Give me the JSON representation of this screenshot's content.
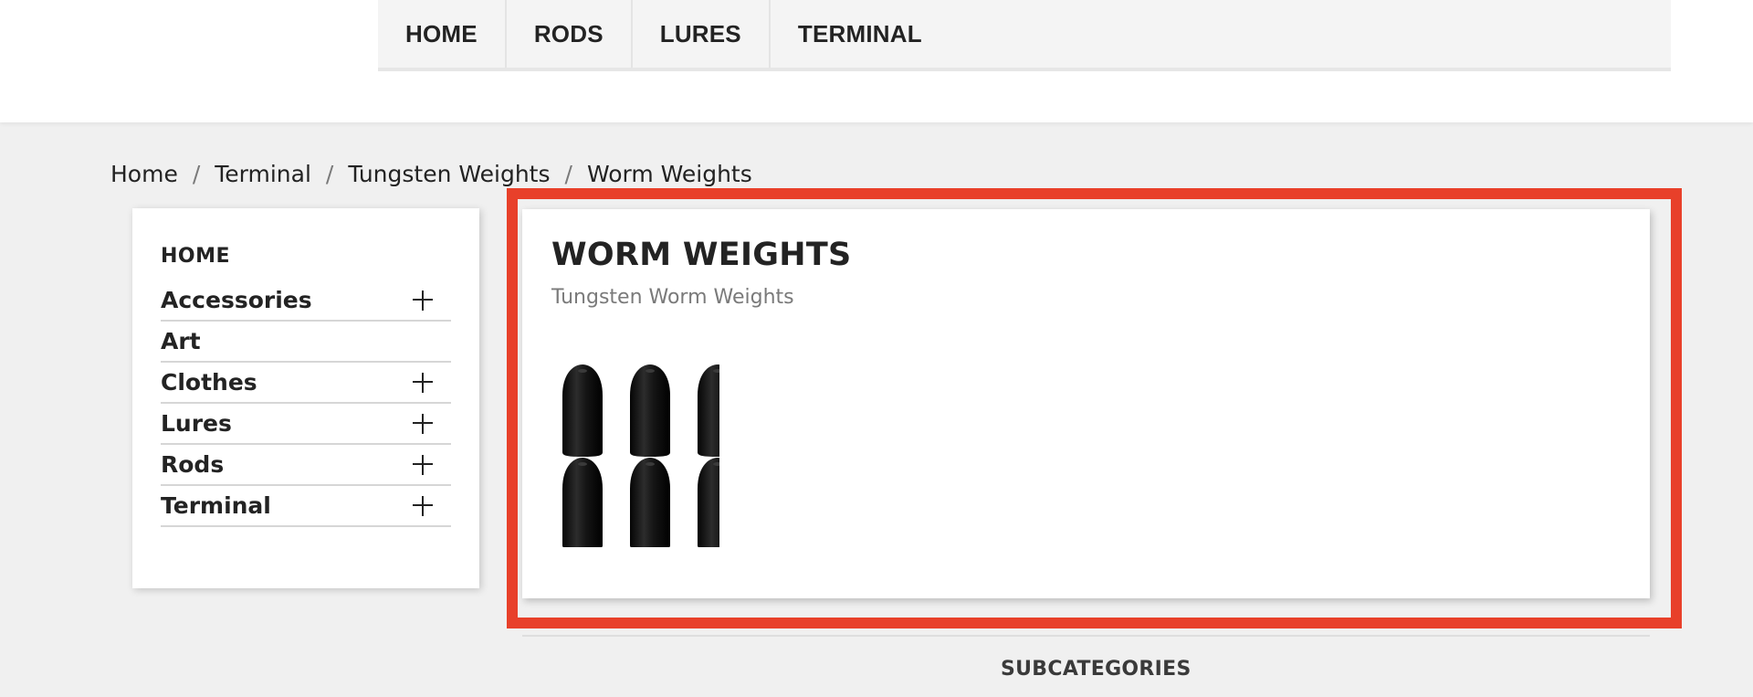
{
  "menu": {
    "items": [
      {
        "label": "HOME"
      },
      {
        "label": "RODS"
      },
      {
        "label": "LURES"
      },
      {
        "label": "TERMINAL"
      }
    ]
  },
  "breadcrumb": {
    "items": [
      "Home",
      "Terminal",
      "Tungsten Weights",
      "Worm Weights"
    ],
    "separator": "/"
  },
  "sidebar": {
    "title": "HOME",
    "categories": [
      {
        "label": "Accessories",
        "expandable": true
      },
      {
        "label": "Art",
        "expandable": false
      },
      {
        "label": "Clothes",
        "expandable": true
      },
      {
        "label": "Lures",
        "expandable": true
      },
      {
        "label": "Rods",
        "expandable": true
      },
      {
        "label": "Terminal",
        "expandable": true
      }
    ]
  },
  "category": {
    "title": "WORM WEIGHTS",
    "description": "Tungsten Worm Weights",
    "image_icon": "worm-weights-image",
    "weight_count": 6
  },
  "subcategories": {
    "title": "SUBCATEGORIES"
  },
  "colors": {
    "highlight": "#e8402a",
    "weight": "#161616"
  }
}
